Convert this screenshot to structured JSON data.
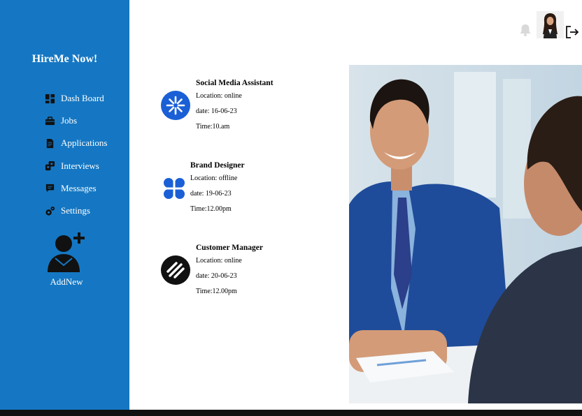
{
  "app": {
    "brand": "HireMe Now!"
  },
  "sidebar": {
    "items": [
      {
        "label": "Dash Board",
        "icon": "dashboard-icon"
      },
      {
        "label": "Jobs",
        "icon": "briefcase-icon"
      },
      {
        "label": "Applications",
        "icon": "document-icon"
      },
      {
        "label": "Interviews",
        "icon": "interview-icon"
      },
      {
        "label": "Messages",
        "icon": "message-icon"
      },
      {
        "label": "Settings",
        "icon": "gear-icon"
      }
    ],
    "add_new": "AddNew"
  },
  "header": {
    "icons": [
      "bell-icon",
      "profile-avatar",
      "logout-icon"
    ]
  },
  "jobs": [
    {
      "title": "Social Media Assistant",
      "location": "Location: online",
      "date": "date: 16-06-23",
      "time": "Time:10.am"
    },
    {
      "title": "Brand Designer",
      "location": "Location: offline",
      "date": "date: 19-06-23",
      "time": "Time:12.00pm"
    },
    {
      "title": "Customer Manager",
      "location": "Location: online",
      "date": "date: 20-06-23",
      "time": "Time:12.00pm"
    }
  ],
  "colors": {
    "sidebar": "#1577c3",
    "accent_blue": "#1a5fd6",
    "text": "#000000"
  }
}
